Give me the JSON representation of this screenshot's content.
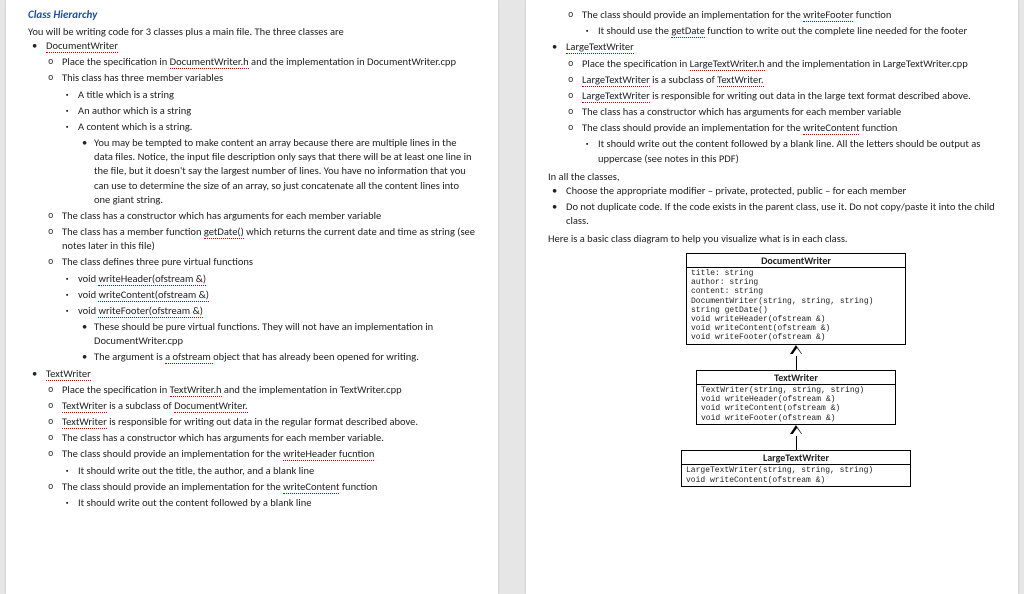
{
  "title": "Class Hierarchy",
  "intro": "You will be writing code for 3 classes plus a main file.  The three classes are",
  "dw": {
    "name": "DocumentWriter",
    "spec": "Place the specification in ",
    "specLink": "DocumentWriter.h",
    "specTail": " and the implementation in DocumentWriter.cpp",
    "mv": "This class has three member variables",
    "mv1": "A title which is a string",
    "mv2": "An author which is a string",
    "mv3": "A content which is a string.",
    "mvNote": "You may be tempted to make content an array because there are multiple lines in the data files.  Notice, the input file description only says that there will be at least one line in the file, but it doesn't say the largest number of lines.  You have no information that you can use to determine the size of an array, so just concatenate all the content lines into one giant string.",
    "ctor": "The class has a constructor which has arguments for each member variable",
    "getdate1": "The class has a member function ",
    "getdateLink": "getDate()",
    "getdate2": " which returns the current date and time as string (see notes later in this file)",
    "pv": "The class defines three pure virtual functions",
    "pv1a": "void ",
    "pv1b": "writeHeader(ofstream &)",
    "pv2a": "void ",
    "pv2b": "writeContent(ofstream &)",
    "pv3a": "void ",
    "pv3b": "writeFooter(ofstream &)",
    "pvNote1": "These should be pure virtual functions.  They will not have an implementation in DocumentWriter.cpp",
    "pvNote2a": "The argument is ",
    "pvNote2b": "a ofstream ",
    "pvNote2c": "object that has already been opened for writing."
  },
  "tw": {
    "name": "TextWriter",
    "spec1": "Place the specification in ",
    "specLink": "TextWriter.h",
    "spec2": " and the implementation in TextWriter.cpp",
    "sub1": "TextWriter",
    "sub2": " is a subclass of ",
    "sub3": "DocumentWriter.",
    "resp1": "TextWriter",
    "resp2": " is responsible for writing out data in the regular format described above.",
    "ctor": "The class has a constructor which has arguments for each member variable.",
    "wh1": "The class should provide an implementation for the ",
    "wh2": "writeHeader fucntion",
    "whNote": "It should write out the title, the author, and a blank line",
    "wc1": "The class should provide an implementation for the ",
    "wc2": "writeContent",
    "wc3": " function",
    "wcNote": "It should write out the content followed by a blank line"
  },
  "twFooter": {
    "wf1": "The class should provide an implementation for the ",
    "wf2": "writeFooter",
    "wf3": " function",
    "wfNote1": "It should use the ",
    "wfNote2": "getDate",
    "wfNote3": " function to write out the complete line needed for the footer"
  },
  "ltw": {
    "name": "LargeTextWriter",
    "spec1": "Place the specification in ",
    "specLink": "LargeTextWriter.h",
    "spec2": " and the implementation in LargeTextWriter.cpp",
    "sub1": "LargeTextWriter",
    "sub2": " is a subclass of ",
    "sub3": "TextWriter.",
    "resp1": "LargeTextWriter",
    "resp2": " is responsible for writing out data in the large text format described above.",
    "ctor": "The class has a constructor which has arguments for each member variable",
    "wc1": "The class should provide an implementation for the ",
    "wc2": "writeContent",
    "wc3": " function",
    "wcNote": "It should write out the content followed by a blank line.  All the letters should be output as uppercase (see notes in this PDF)"
  },
  "all": {
    "head": "In all the classes,",
    "mod": "Choose the appropriate modifier – private, protected, public – for each member",
    "dup": "Do not duplicate code.  If the code exists in the parent class, use it.  Do not copy/paste it into the child class."
  },
  "diagIntro": "Here is a basic class diagram to help you visualize what is in each class.",
  "uml": {
    "dw": {
      "name": "DocumentWriter",
      "body": "title: string\nauthor: string\ncontent: string\nDocumentWriter(string, string, string)\nstring getDate()\nvoid writeHeader(ofstream &)\nvoid writeContent(ofstream &)\nvoid writeFooter(ofstream &)"
    },
    "tw": {
      "name": "TextWriter",
      "body": "TextWriter(string, string, string)\nvoid writeHeader(ofstream &)\nvoid writeContent(ofstream &)\nvoid writeFooter(ofstream &)"
    },
    "ltw": {
      "name": "LargeTextWriter",
      "body": "LargeTextWriter(string, string, string)\nvoid writeContent(ofstream &)"
    }
  }
}
